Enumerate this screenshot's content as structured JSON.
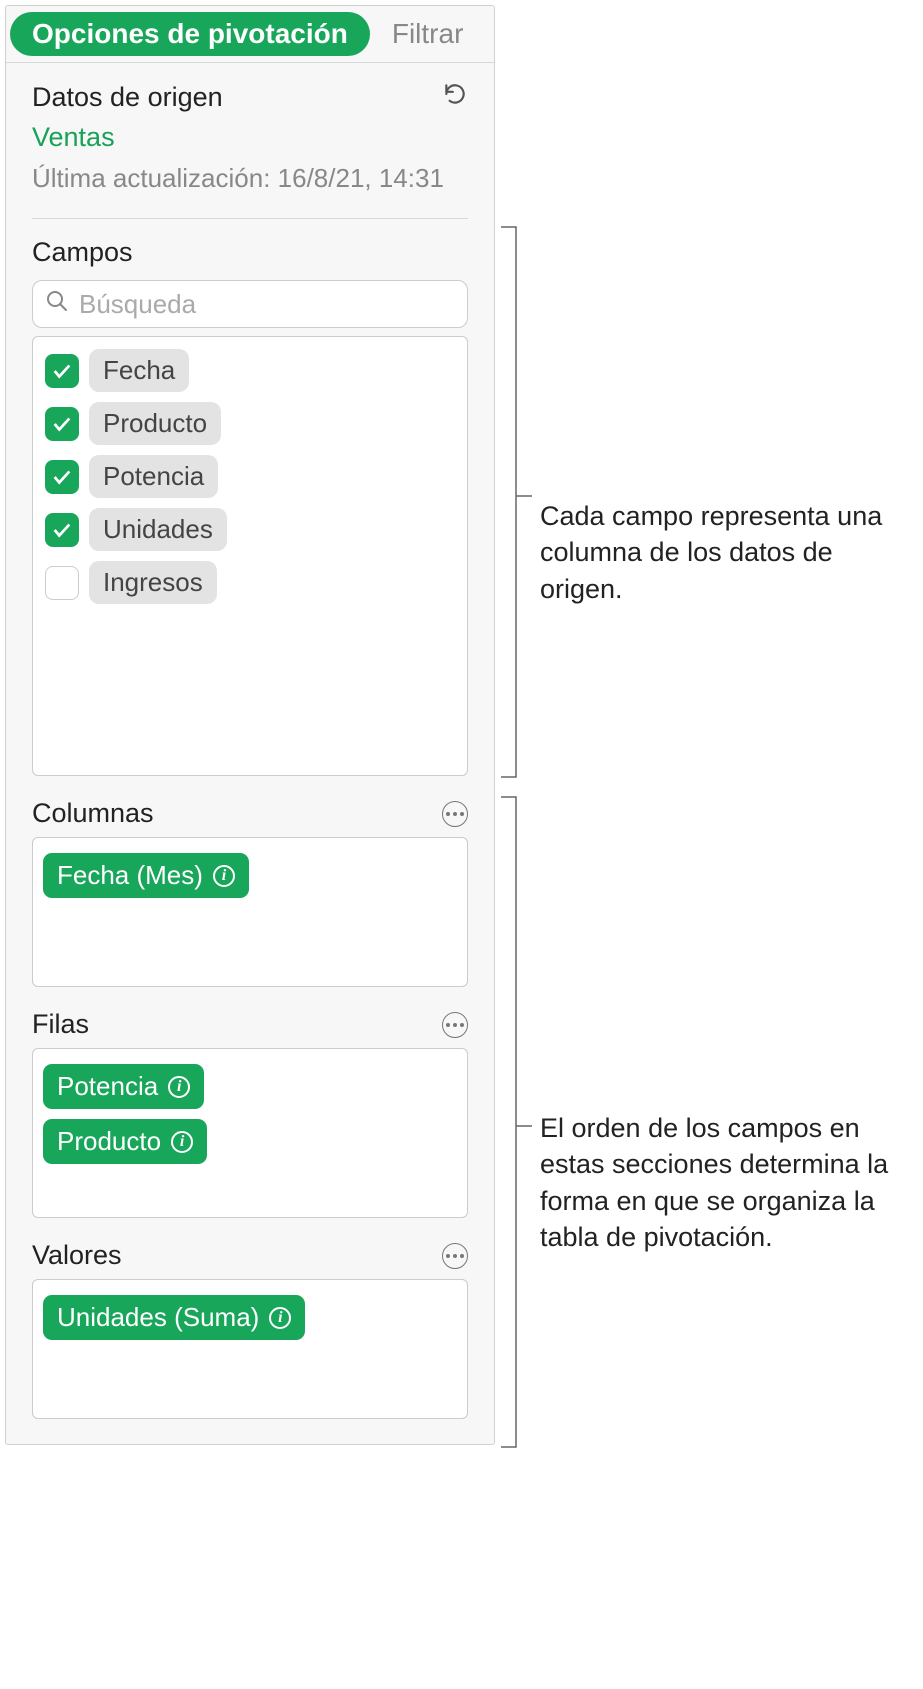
{
  "tabs": {
    "active": "Opciones de pivotación",
    "other": "Filtrar"
  },
  "source": {
    "header": "Datos de origen",
    "name": "Ventas",
    "updated": "Última actualización: 16/8/21, 14:31"
  },
  "fields": {
    "title": "Campos",
    "search_placeholder": "Búsqueda",
    "items": [
      {
        "label": "Fecha",
        "checked": true
      },
      {
        "label": "Producto",
        "checked": true
      },
      {
        "label": "Potencia",
        "checked": true
      },
      {
        "label": "Unidades",
        "checked": true
      },
      {
        "label": "Ingresos",
        "checked": false
      }
    ]
  },
  "columns": {
    "title": "Columnas",
    "items": [
      "Fecha (Mes)"
    ]
  },
  "rows": {
    "title": "Filas",
    "items": [
      "Potencia",
      "Producto"
    ]
  },
  "values": {
    "title": "Valores",
    "items": [
      "Unidades (Suma)"
    ]
  },
  "callouts": {
    "fields": "Cada campo representa una columna de los datos de origen.",
    "zones": "El orden de los campos en estas secciones determina la forma en que se organiza la tabla de pivotación."
  }
}
